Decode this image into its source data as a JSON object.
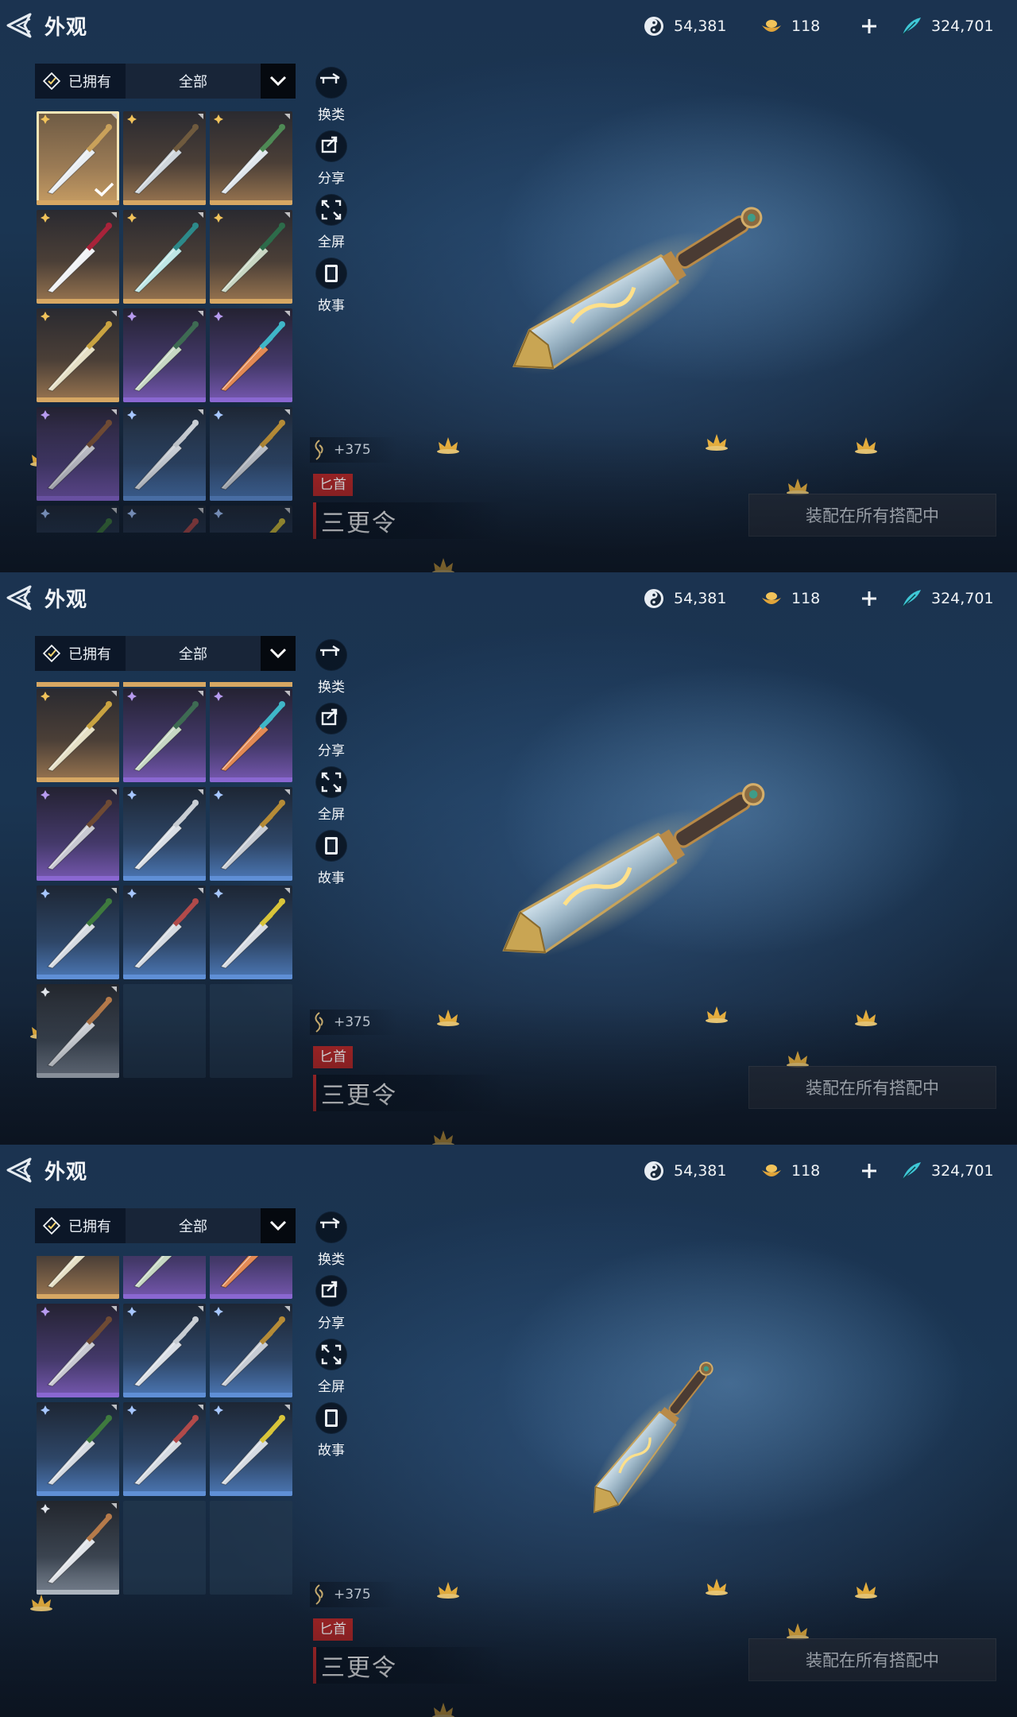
{
  "title": "外观",
  "currencies": {
    "jade": "54,381",
    "ingot": "118",
    "feather": "324,701"
  },
  "filter": {
    "owned_label": "已拥有",
    "category_label": "全部"
  },
  "side_actions": [
    {
      "label": "换类",
      "icon": "swap-weapon-icon"
    },
    {
      "label": "分享",
      "icon": "share-icon"
    },
    {
      "label": "全屏",
      "icon": "fullscreen-icon"
    },
    {
      "label": "故事",
      "icon": "story-book-icon"
    }
  ],
  "item": {
    "power": "+375",
    "category": "匕首",
    "name": "三更令"
  },
  "equip_status": "装配在所有搭配中",
  "colors": {
    "gold": "#d6a763",
    "purple": "#8a67d1",
    "blue": "#5f8fd6",
    "white": "#b9c2cc",
    "tag_red": "#b32626",
    "feather_cyan": "#3fc7d6"
  },
  "frames": [
    {
      "scroll": "top",
      "selected": "dagger-01"
    },
    {
      "scroll": "middle",
      "selected": "dagger-01"
    },
    {
      "scroll": "bottom",
      "selected": "dagger-01"
    }
  ],
  "inventory": [
    {
      "id": "dagger-01",
      "rarity": "gold"
    },
    {
      "id": "dagger-02",
      "rarity": "gold"
    },
    {
      "id": "dagger-03",
      "rarity": "gold"
    },
    {
      "id": "dagger-04",
      "rarity": "gold"
    },
    {
      "id": "dagger-05",
      "rarity": "gold"
    },
    {
      "id": "dagger-06",
      "rarity": "gold"
    },
    {
      "id": "dagger-07",
      "rarity": "gold"
    },
    {
      "id": "dagger-08",
      "rarity": "purple"
    },
    {
      "id": "dagger-09",
      "rarity": "purple"
    },
    {
      "id": "dagger-10",
      "rarity": "purple"
    },
    {
      "id": "dagger-11",
      "rarity": "blue"
    },
    {
      "id": "dagger-12",
      "rarity": "blue"
    },
    {
      "id": "dagger-13",
      "rarity": "blue"
    },
    {
      "id": "dagger-14",
      "rarity": "blue"
    },
    {
      "id": "dagger-15",
      "rarity": "blue"
    },
    {
      "id": "dagger-16",
      "rarity": "white"
    }
  ]
}
